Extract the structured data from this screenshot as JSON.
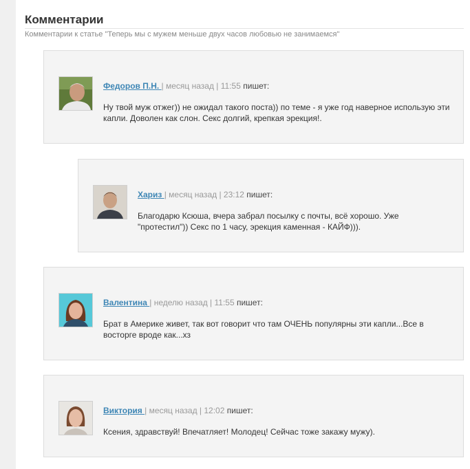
{
  "section": {
    "title": "Комментарии",
    "subtitle": "Комментарии к статье \"Теперь мы с мужем меньше двух часов любовью не занимаемся\""
  },
  "comments": [
    {
      "author": "Федоров П.Н. ",
      "sep1": "| ",
      "time_ago": "месяц назад",
      "sep2": " | ",
      "clock": "11:55",
      "says": " пишет:",
      "text": "Ну твой муж отжег)) не ожидал такого поста)) по теме - я уже год наверное использую эти капли. Доволен как слон. Секс долгий, крепкая эрекция!.",
      "avatar": "avatar-fedorov"
    },
    {
      "author": "Хариз ",
      "sep1": "| ",
      "time_ago": "месяц назад",
      "sep2": " | ",
      "clock": "23:12",
      "says": " пишет:",
      "text": "Благодарю Ксюша, вчера забрал посылку с почты, всё хорошо. Уже \"протестил\")) Секс по 1 часу, эрекция каменная - КАЙФ))).",
      "avatar": "avatar-hariz"
    },
    {
      "author": "Валентина ",
      "sep1": "| ",
      "time_ago": "неделю назад",
      "sep2": " | ",
      "clock": "11:55",
      "says": " пишет:",
      "text": "Брат в Америке живет, так вот говорит что там ОЧЕНЬ популярны эти капли...Все в восторге вроде как...хз",
      "avatar": "avatar-valentina"
    },
    {
      "author": "Виктория ",
      "sep1": "| ",
      "time_ago": "месяц назад",
      "sep2": " | ",
      "clock": "12:02",
      "says": " пишет:",
      "text": "Ксения, здравствуй! Впечатляет! Молодец! Сейчас тоже закажу мужу).",
      "avatar": "avatar-viktoria"
    }
  ],
  "colors": {
    "author_link": "#3e86b5",
    "panel_bg": "#f4f4f4",
    "panel_border": "#dddddd",
    "muted_text": "#999999"
  }
}
